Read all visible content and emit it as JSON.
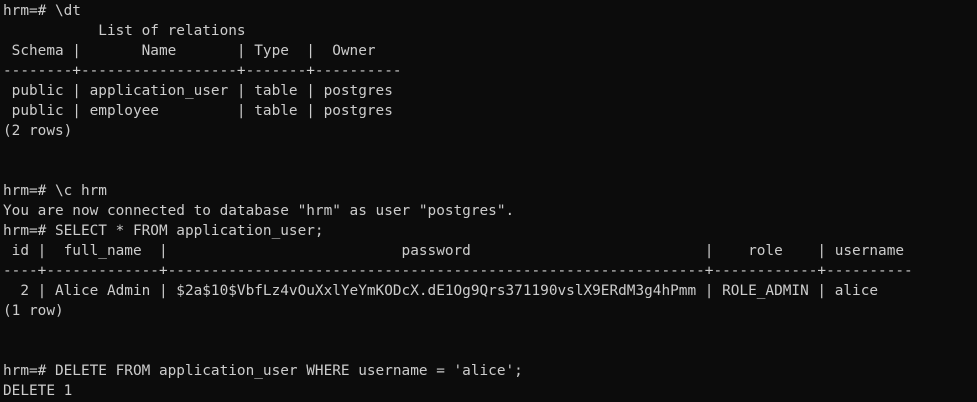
{
  "terminal": {
    "lines": [
      "hrm=# \\dt",
      "           List of relations",
      " Schema |       Name       | Type  |  Owner",
      "--------+------------------+-------+----------",
      " public | application_user | table | postgres",
      " public | employee         | table | postgres",
      "(2 rows)",
      "",
      "",
      "hrm=# \\c hrm",
      "You are now connected to database \"hrm\" as user \"postgres\".",
      "hrm=# SELECT * FROM application_user;",
      " id |  full_name  |                           password                           |    role    | username",
      "----+-------------+--------------------------------------------------------------+------------+----------",
      "  2 | Alice Admin | $2a$10$VbfLz4vOuXxlYeYmKODcX.dE1Og9Qrs371190vslX9ERdM3g4hPmm | ROLE_ADMIN | alice",
      "(1 row)",
      "",
      "",
      "hrm=# DELETE FROM application_user WHERE username = 'alice';",
      "DELETE 1"
    ]
  }
}
